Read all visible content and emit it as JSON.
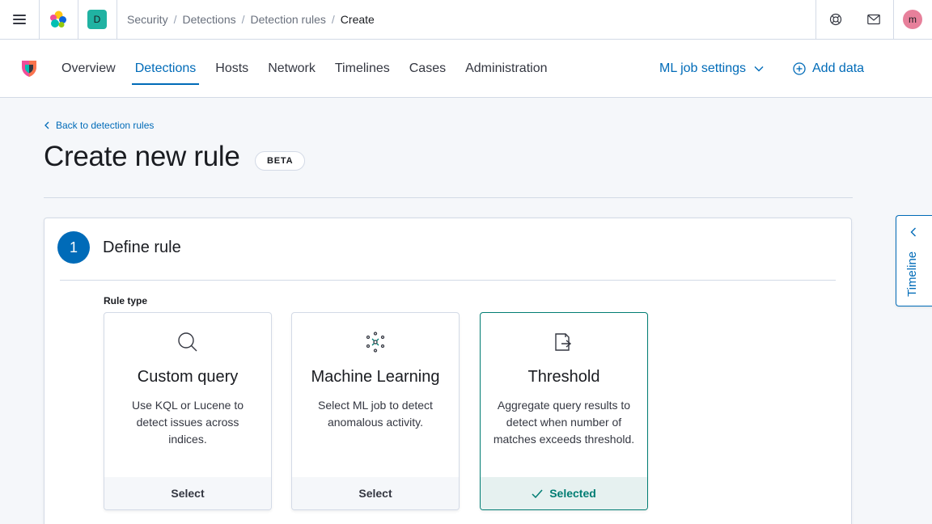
{
  "header": {
    "space_initial": "D",
    "breadcrumbs": [
      "Security",
      "Detections",
      "Detection rules"
    ],
    "current_crumb": "Create",
    "user_initial": "m"
  },
  "nav": {
    "tabs": [
      {
        "label": "Overview",
        "active": false
      },
      {
        "label": "Detections",
        "active": true
      },
      {
        "label": "Hosts",
        "active": false
      },
      {
        "label": "Network",
        "active": false
      },
      {
        "label": "Timelines",
        "active": false
      },
      {
        "label": "Cases",
        "active": false
      },
      {
        "label": "Administration",
        "active": false
      }
    ],
    "ml_job_settings": "ML job settings",
    "add_data": "Add data"
  },
  "page": {
    "back_link": "Back to detection rules",
    "title": "Create new rule",
    "badge": "BETA"
  },
  "step": {
    "number": "1",
    "title": "Define rule",
    "rule_type_label": "Rule type",
    "cards": [
      {
        "icon": "search-icon",
        "title": "Custom query",
        "description": "Use KQL or Lucene to detect issues across indices.",
        "action": "Select",
        "selected": false
      },
      {
        "icon": "machine-learning-icon",
        "title": "Machine Learning",
        "description": "Select ML job to detect anomalous activity.",
        "action": "Select",
        "selected": false
      },
      {
        "icon": "threshold-icon",
        "title": "Threshold",
        "description": "Aggregate query results to detect when number of matches exceeds threshold.",
        "action": "Selected",
        "selected": true
      }
    ]
  },
  "timeline": {
    "label": "Timeline"
  },
  "colors": {
    "primary": "#006bb8",
    "success": "#017d73",
    "space_badge": "#20b2a2",
    "avatar": "#e7809b"
  }
}
